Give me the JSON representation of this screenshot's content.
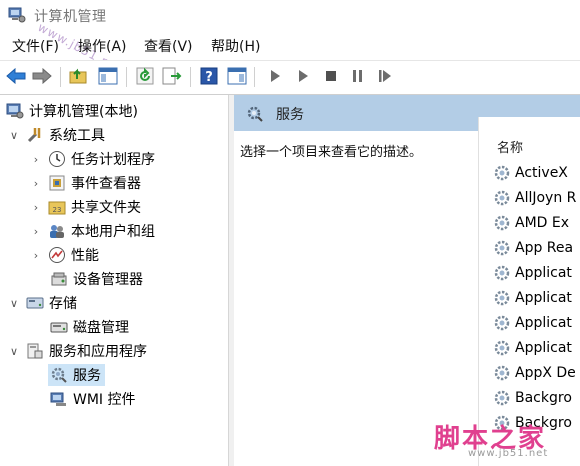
{
  "window": {
    "title": "计算机管理",
    "icon": "computer-management-icon"
  },
  "menu": [
    "文件(F)",
    "操作(A)",
    "查看(V)",
    "帮助(H)"
  ],
  "toolbar_icons": [
    "back-arrow-icon",
    "forward-arrow-icon",
    "up-folder-icon",
    "show-hide-tree-icon",
    "refresh-icon",
    "export-list-icon",
    "help-icon",
    "action-pane-icon",
    "start-icon",
    "start-alt-icon",
    "stop-icon",
    "pause-icon",
    "restart-icon"
  ],
  "tree": {
    "root": "计算机管理(本地)",
    "items": [
      {
        "label": "系统工具",
        "expanded": true
      },
      {
        "label": "任务计划程序"
      },
      {
        "label": "事件查看器"
      },
      {
        "label": "共享文件夹"
      },
      {
        "label": "本地用户和组"
      },
      {
        "label": "性能"
      },
      {
        "label": "设备管理器"
      },
      {
        "label": "存储",
        "expanded": true
      },
      {
        "label": "磁盘管理"
      },
      {
        "label": "服务和应用程序",
        "expanded": true
      },
      {
        "label": "服务",
        "selected": true
      },
      {
        "label": "WMI 控件"
      }
    ]
  },
  "pane": {
    "title": "服务",
    "description": "选择一个项目来查看它的描述。",
    "column_name": "名称",
    "services": [
      "ActiveX",
      "AllJoyn R",
      "AMD Ex",
      "App Rea",
      "Applicat",
      "Applicat",
      "Applicat",
      "Applicat",
      "AppX De",
      "Backgro",
      "Backgro"
    ]
  },
  "colors": {
    "header_bg": "#b3cde6",
    "selected_bg": "#cce4f7",
    "accent_blue": "#1a6fc1"
  },
  "watermarks": {
    "left_text": "www.jb51.net",
    "br_main": "脚本之家",
    "br_sub": "www.jb51.net"
  }
}
